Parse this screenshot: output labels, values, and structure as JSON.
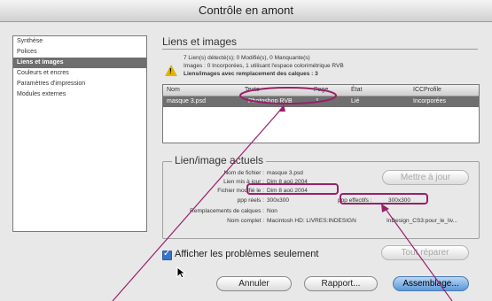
{
  "window": {
    "title": "Contrôle en amont"
  },
  "sidebar": {
    "items": [
      {
        "label": "Synthèse",
        "selected": false
      },
      {
        "label": "Polices",
        "selected": false
      },
      {
        "label": "Liens et images",
        "selected": true
      },
      {
        "label": "Couleurs et encres",
        "selected": false
      },
      {
        "label": "Paramètres d'impression",
        "selected": false
      },
      {
        "label": "Modules externes",
        "selected": false
      }
    ]
  },
  "links": {
    "section_title": "Liens et images",
    "status": [
      "7 Lien(s) détecté(s); 0 Modifié(s), 0 Manquante(s)",
      "Images : 0 Incorporées, 1 utilisant l'espace colorimétrique RVB",
      "Liens/images avec remplacement des calques : 3"
    ],
    "warning_icon": "warning-triangle-icon",
    "columns": [
      "Nom",
      "Texte",
      "Page",
      "État",
      "ICCProfile"
    ],
    "rows": [
      [
        "masque 3.psd",
        "Photoshop RVB",
        "1",
        "Lié",
        "Incorporées"
      ]
    ]
  },
  "current": {
    "title": "Lien/image actuels",
    "fields": [
      {
        "label": "Nom de fichier :",
        "value": "masque 3.psd"
      },
      {
        "label": "Lien mis à jour :",
        "value": "Dim 8 aoû 2004"
      },
      {
        "label": "Fichier modifié le :",
        "value": "Dim 8 aoû 2004"
      }
    ],
    "ppi_label": "ppp réels :",
    "ppi_value": "300x300",
    "eff_label": "ppp effectifs :",
    "eff_value": "300x300",
    "layers_label": "Remplacements de calques :",
    "layers_value": "Non",
    "path_label": "Nom complet :",
    "path_value": "Macintosh HD: LIVRES:INDESIGN",
    "path_value_right": "InDesign_CS3:pour_le_liv...",
    "update_button": "Mettre à jour"
  },
  "options": {
    "show_problems_label": "Afficher les problèmes seulement",
    "show_problems_checked": true
  },
  "buttons": {
    "repair": "Tout réparer",
    "cancel": "Annuler",
    "report": "Rapport...",
    "package": "Assemblage..."
  },
  "colors": {
    "accent": "#5b97d9",
    "annotation": "#9a1f6a",
    "warning": "#e0b400"
  }
}
